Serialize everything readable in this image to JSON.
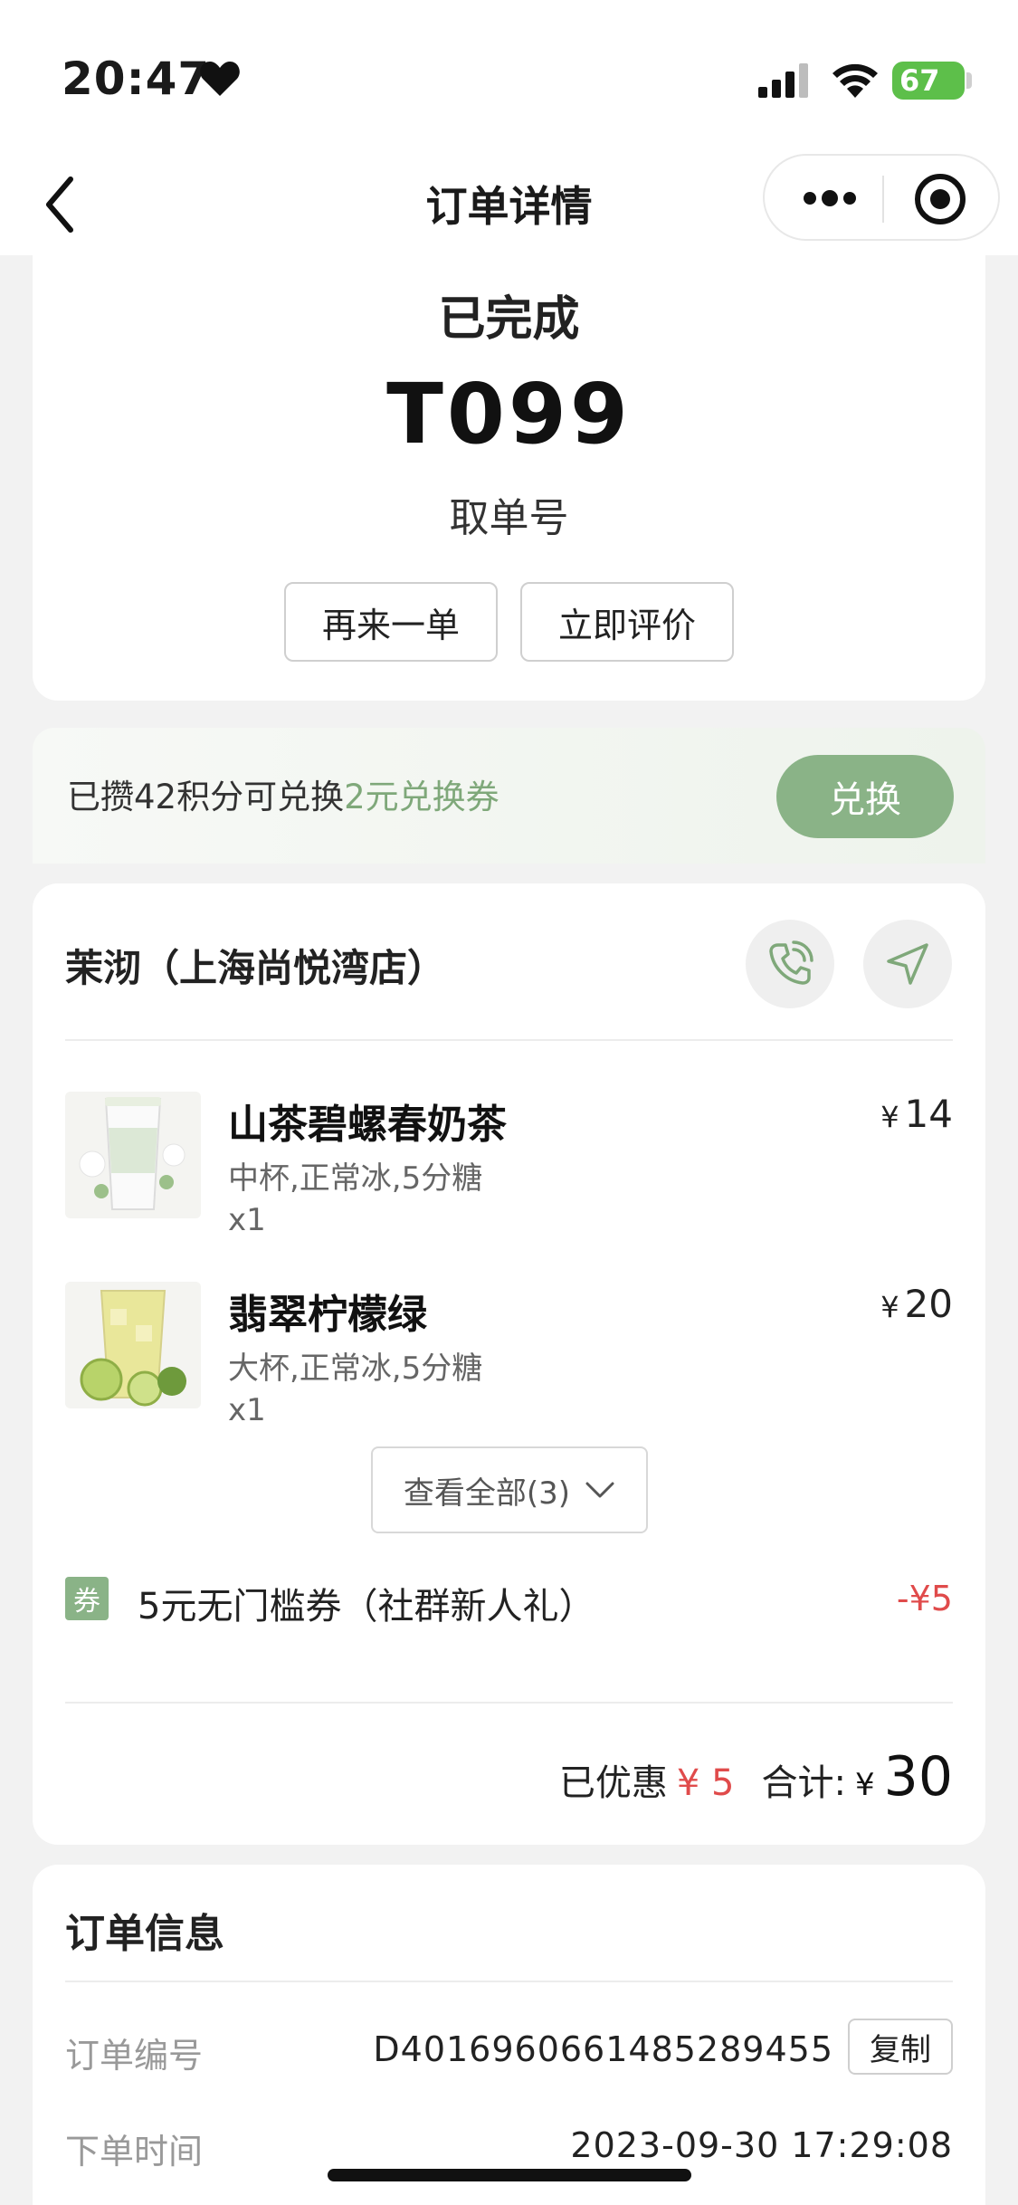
{
  "status_bar": {
    "time": "20:47",
    "battery": "67"
  },
  "nav": {
    "title": "订单详情"
  },
  "order_status": {
    "status": "已完成",
    "pickup_number": "T099",
    "pickup_label": "取单号",
    "reorder_label": "再来一单",
    "review_label": "立即评价"
  },
  "points": {
    "text_prefix": "已攒42积分可兑换",
    "text_highlight": "2元兑换券",
    "exchange_label": "兑换"
  },
  "store": {
    "name": "茉沏（上海尚悦湾店）"
  },
  "items": [
    {
      "name": "山茶碧螺春奶茶",
      "spec": "中杯,正常冰,5分糖",
      "qty": "x1",
      "currency": "¥",
      "price": "14"
    },
    {
      "name": "翡翠柠檬绿",
      "spec": "大杯,正常冰,5分糖",
      "qty": "x1",
      "currency": "¥",
      "price": "20"
    }
  ],
  "view_all_label": "查看全部(3)",
  "coupon": {
    "tag": "券",
    "name": "5元无门槛券（社群新人礼）",
    "amount": "-¥5"
  },
  "totals": {
    "discount_label": "已优惠",
    "discount_value": "¥ 5",
    "total_label": "合计:",
    "currency": "¥",
    "total_value": "30"
  },
  "order_info": {
    "title": "订单信息",
    "order_no_label": "订单编号",
    "order_no": "D4016960661485289455",
    "copy_label": "复制",
    "time_label": "下单时间",
    "time_value": "2023-09-30 17:29:08"
  },
  "colors": {
    "accent_green": "#8ab387",
    "highlight_green": "#7fa87a",
    "discount_red": "#e04b4b"
  }
}
